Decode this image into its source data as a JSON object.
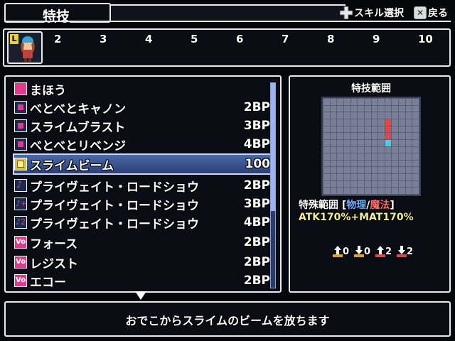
{
  "header": {
    "title": "特技",
    "hint_select_label": "スキル選択",
    "hint_back_label": "戻る",
    "hint_select_icon": "dpad-icon",
    "hint_back_icon": "x-button-icon"
  },
  "party": {
    "level_badge": "L",
    "slots": [
      "2",
      "3",
      "4",
      "5",
      "6",
      "7",
      "8",
      "9",
      "10"
    ]
  },
  "skills": [
    {
      "name": "まほう",
      "cost": "",
      "icon": "magic-book-icon",
      "color": "#e23a8a"
    },
    {
      "name": "べとべとキャノン",
      "cost": "2BP",
      "icon": "skill-icon",
      "color": "#e23a8a"
    },
    {
      "name": "スライムブラスト",
      "cost": "3BP",
      "icon": "skill-icon",
      "color": "#e23a8a"
    },
    {
      "name": "べとべとリベンジ",
      "cost": "4BP",
      "icon": "skill-icon",
      "color": "#e23a8a"
    },
    {
      "name": "スライムビーム",
      "cost": "100",
      "icon": "skill-icon",
      "color": "#d8c040",
      "selected": true
    },
    {
      "name": "プライヴェイト・ロードショウ",
      "cost": "2BP",
      "icon": "music-icon",
      "color": "#e23a8a"
    },
    {
      "name": "プライヴェイト・ロードショウ",
      "cost": "3BP",
      "icon": "music-plus-icon",
      "color": "#e23a8a"
    },
    {
      "name": "プライヴェイト・ロードショウ",
      "cost": "4BP",
      "icon": "music-plus2-icon",
      "color": "#e23a8a"
    },
    {
      "name": "フォース",
      "cost": "2BP",
      "icon": "vo-icon",
      "color": "#e23a8a"
    },
    {
      "name": "レジスト",
      "cost": "2BP",
      "icon": "vo-icon",
      "color": "#e23a8a"
    },
    {
      "name": "エコー",
      "cost": "2BP",
      "icon": "vo-icon",
      "color": "#e23a8a"
    }
  ],
  "range_panel": {
    "title": "特技範囲",
    "stats": [
      "0",
      "0",
      "2",
      "2"
    ],
    "type_label": "特殊範囲 [",
    "type_physical": "物理",
    "type_sep": "/",
    "type_magic": "魔法",
    "type_close": "]",
    "formula": "ATK170%+MAT170%",
    "colors": {
      "physical": "#70b0ff",
      "magic": "#ff6a6a",
      "red_cell": "#e04848",
      "cyan_cell": "#48d0e0"
    }
  },
  "description": "おでこからスライムのビームを放ちます"
}
